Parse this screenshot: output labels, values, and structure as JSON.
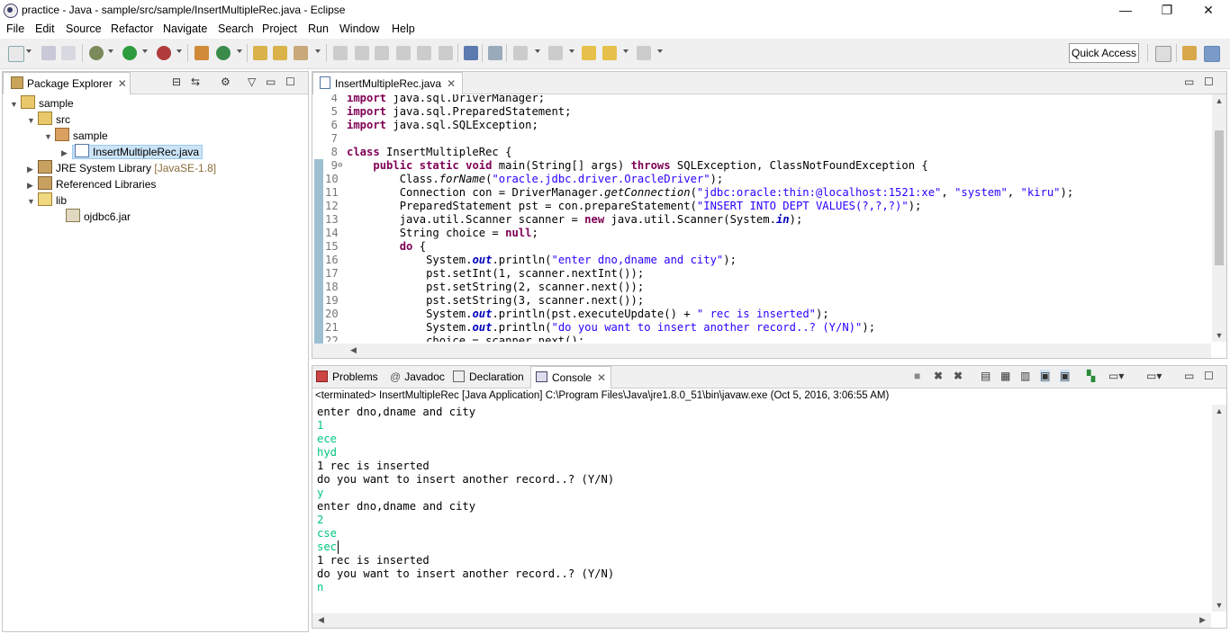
{
  "window": {
    "title": "practice - Java - sample/src/sample/InsertMultipleRec.java - Eclipse",
    "minimize": "—",
    "restore": "❐",
    "close": "✕"
  },
  "menu": [
    "File",
    "Edit",
    "Source",
    "Refactor",
    "Navigate",
    "Search",
    "Project",
    "Run",
    "Window",
    "Help"
  ],
  "toolbar": {
    "quick_access": "Quick Access"
  },
  "package_explorer": {
    "tab_label": "Package Explorer",
    "tree": {
      "project": "sample",
      "src": "src",
      "package": "sample",
      "file": "InsertMultipleRec.java",
      "jre": "JRE System Library",
      "jre_version": "[JavaSE-1.8]",
      "ref_libs": "Referenced Libraries",
      "lib": "lib",
      "jar": "ojdbc6.jar"
    }
  },
  "editor": {
    "tab_label": "InsertMultipleRec.java",
    "line_numbers": [
      "4",
      "5",
      "6",
      "7",
      "8",
      "9",
      "10",
      "11",
      "12",
      "13",
      "14",
      "15",
      "16",
      "17",
      "18",
      "19",
      "20",
      "21",
      "22"
    ]
  },
  "bottom": {
    "tabs": {
      "problems": "Problems",
      "javadoc": "Javadoc",
      "declaration": "Declaration",
      "console": "Console"
    },
    "status": "<terminated> InsertMultipleRec [Java Application] C:\\Program Files\\Java\\jre1.8.0_51\\bin\\javaw.exe (Oct 5, 2016, 3:06:55 AM)",
    "console_lines": [
      {
        "text": "enter dno,dname and city",
        "kind": "out"
      },
      {
        "text": "1",
        "kind": "in"
      },
      {
        "text": "ece",
        "kind": "in"
      },
      {
        "text": "hyd",
        "kind": "in"
      },
      {
        "text": "1 rec is inserted",
        "kind": "out"
      },
      {
        "text": "do you want to insert another record..? (Y/N)",
        "kind": "out"
      },
      {
        "text": "y",
        "kind": "in"
      },
      {
        "text": "enter dno,dname and city",
        "kind": "out"
      },
      {
        "text": "2",
        "kind": "in"
      },
      {
        "text": "cse",
        "kind": "in"
      },
      {
        "text": "sec",
        "kind": "in"
      },
      {
        "text": "1 rec is inserted",
        "kind": "out"
      },
      {
        "text": "do you want to insert another record..? (Y/N)",
        "kind": "out"
      },
      {
        "text": "n",
        "kind": "in"
      }
    ]
  },
  "code": {
    "l4_kw": "import",
    "l4_rest": " java.sql.DriverManager;",
    "l5_kw": "import",
    "l5_rest": " java.sql.PreparedStatement;",
    "l6_kw": "import",
    "l6_rest": " java.sql.SQLException;",
    "l8_kw": "class",
    "l8_rest": " InsertMultipleRec {",
    "l9_kw1": "public",
    "l9_kw2": "static",
    "l9_kw3": "void",
    "l9_a": " main(String[] args) ",
    "l9_kw4": "throws",
    "l9_b": " SQLException, ClassNotFoundException {",
    "l10_a": "Class.",
    "l10_m": "forName",
    "l10_b": "(",
    "l10_s": "\"oracle.jdbc.driver.OracleDriver\"",
    "l10_c": ");",
    "l11_a": "Connection con = DriverManager.",
    "l11_m": "getConnection",
    "l11_b": "(",
    "l11_s1": "\"jdbc:oracle:thin:@localhost:1521:xe\"",
    "l11_c": ", ",
    "l11_s2": "\"system\"",
    "l11_d": ", ",
    "l11_s3": "\"kiru\"",
    "l11_e": ");",
    "l12_a": "PreparedStatement pst = con.prepareStatement(",
    "l12_s": "\"INSERT INTO DEPT VALUES(?,?,?)\"",
    "l12_b": ");",
    "l13_a": "java.util.Scanner scanner = ",
    "l13_kw": "new",
    "l13_b": " java.util.Scanner(System.",
    "l13_f": "in",
    "l13_c": ");",
    "l14_a": "String choice = ",
    "l14_kw": "null",
    "l14_b": ";",
    "l15_kw": "do",
    "l15_b": " {",
    "l16_a": "System.",
    "l16_f": "out",
    "l16_b": ".println(",
    "l16_s": "\"enter dno,dname and city\"",
    "l16_c": ");",
    "l17": "pst.setInt(1, scanner.nextInt());",
    "l18": "pst.setString(2, scanner.next());",
    "l19": "pst.setString(3, scanner.next());",
    "l20_a": "System.",
    "l20_f": "out",
    "l20_b": ".println(pst.executeUpdate() + ",
    "l20_s": "\" rec is inserted\"",
    "l20_c": ");",
    "l21_a": "System.",
    "l21_f": "out",
    "l21_b": ".println(",
    "l21_s": "\"do you want to insert another record..? (Y/N)\"",
    "l21_c": ");",
    "l22": "choice = scanner.next();"
  }
}
